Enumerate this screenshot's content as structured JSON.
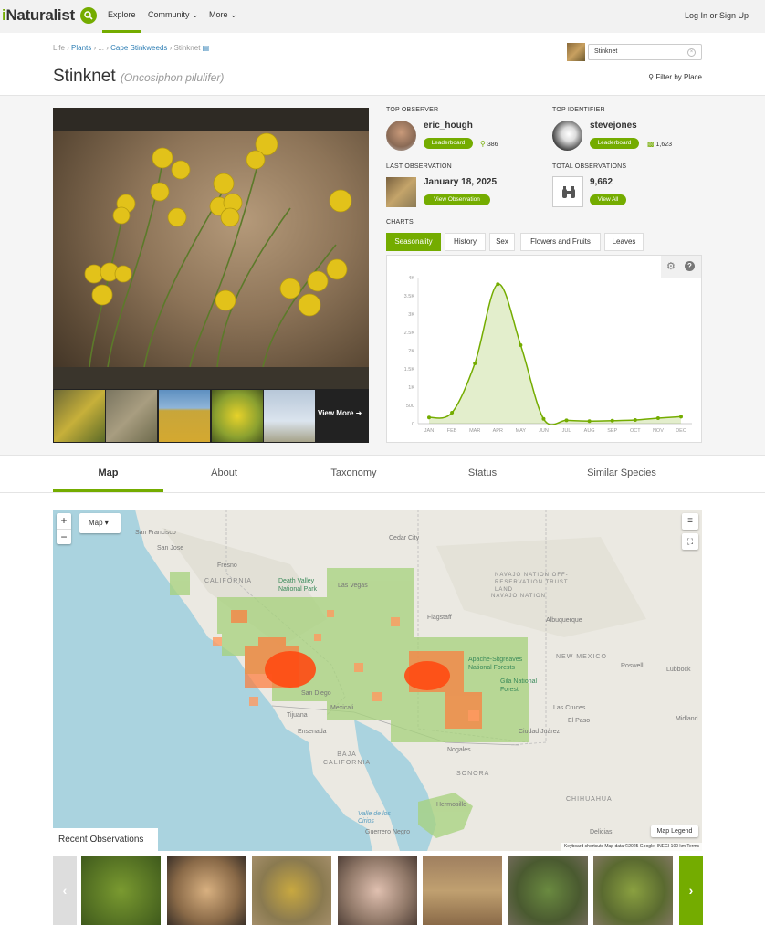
{
  "header": {
    "logo_prefix": "i",
    "logo_text": "Naturalist",
    "nav": {
      "explore": "Explore",
      "community": "Community",
      "more": "More"
    },
    "login": "Log In or Sign Up"
  },
  "breadcrumb": {
    "life": "Life",
    "plants": "Plants",
    "ellipsis": "...",
    "cape_stinkweeds": "Cape Stinkweeds",
    "current": "Stinknet"
  },
  "taxon_search": {
    "value": "Stinknet"
  },
  "title": {
    "common_name": "Stinknet",
    "scientific_name": "(Oncosiphon pilulifer)"
  },
  "filter_place": "Filter by Place",
  "photos": {
    "view_more": "View More"
  },
  "top_observer": {
    "label": "TOP OBSERVER",
    "name": "eric_hough",
    "button": "Leaderboard",
    "count": "386",
    "icon": "binoculars-icon"
  },
  "top_identifier": {
    "label": "TOP IDENTIFIER",
    "name": "stevejones",
    "button": "Leaderboard",
    "count": "1,623",
    "icon": "identify-icon"
  },
  "last_observation": {
    "label": "LAST OBSERVATION",
    "date": "January 18, 2025",
    "button": "View Observation"
  },
  "total_observations": {
    "label": "TOTAL OBSERVATIONS",
    "count": "9,662",
    "button": "View All"
  },
  "charts": {
    "label": "CHARTS",
    "tabs": [
      "Seasonality",
      "History",
      "Sex",
      "Flowers and Fruits",
      "Leaves"
    ],
    "active_tab": "Seasonality"
  },
  "chart_data": {
    "type": "area",
    "categories": [
      "JAN",
      "FEB",
      "MAR",
      "APR",
      "MAY",
      "JUN",
      "JUL",
      "AUG",
      "SEP",
      "OCT",
      "NOV",
      "DEC"
    ],
    "values": [
      170,
      300,
      1650,
      3820,
      2150,
      130,
      90,
      70,
      80,
      100,
      150,
      190
    ],
    "yticks": [
      "0",
      "500",
      "1K",
      "1.5K",
      "2K",
      "2.5K",
      "3K",
      "3.5K",
      "4K"
    ],
    "ylim": [
      0,
      4000
    ],
    "color": "#74ac00"
  },
  "tabs": [
    "Map",
    "About",
    "Taxonomy",
    "Status",
    "Similar Species"
  ],
  "map": {
    "zoom_in": "+",
    "zoom_out": "−",
    "type": "Map",
    "legend": "Map Legend",
    "attribution": "Keyboard shortcuts   Map data ©2025 Google, INEGI   100 km   Terms",
    "labels": {
      "san_francisco": "San Francisco",
      "san_jose": "San Jose",
      "fresno": "Fresno",
      "california": "CALIFORNIA",
      "death_valley": "Death Valley National Park",
      "las_vegas": "Las Vegas",
      "cedar_city": "Cedar City",
      "navajo": "NAVAJO NATION OFF-RESERVATION TRUST LAND",
      "navajo_nation": "NAVAJO NATION",
      "albuquerque": "Albuquerque",
      "flagstaff": "Flagstaff",
      "new_mexico": "NEW MEXICO",
      "sitgreaves": "Apache-Sitgreaves National Forests",
      "gila": "Gila National Forest",
      "las_cruces": "Las Cruces",
      "ciudad_juarez": "Ciudad Juárez",
      "tijuana": "Tijuana",
      "san_diego": "San Diego",
      "mexicali": "Mexicali",
      "ensenada": "Ensenada",
      "baja": "BAJA CALIFORNIA",
      "sonora": "SONORA",
      "hermosillo": "Hermosillo",
      "chihuahua": "CHIHUAHUA",
      "nogales": "Nogales",
      "roswell": "Roswell",
      "lubbock": "Lubbock",
      "midland": "Midland",
      "el_paso": "El Paso",
      "valle_cirios": "Valle de los Cirios",
      "guerrero": "Guerrero Negro",
      "delicias": "Delicias"
    }
  },
  "recent": {
    "label": "Recent Observations",
    "prev": "‹",
    "next": "›"
  }
}
